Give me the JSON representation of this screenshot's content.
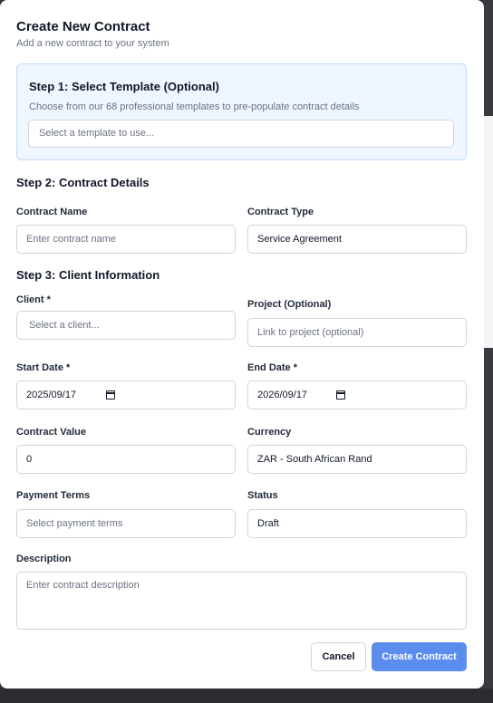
{
  "modal": {
    "title": "Create New Contract",
    "subtitle": "Add a new contract to your system"
  },
  "step1": {
    "heading": "Step 1: Select Template (Optional)",
    "description": "Choose from our 68 professional templates to pre-populate contract details",
    "template_placeholder": "Select a template to use..."
  },
  "step2": {
    "heading": "Step 2: Contract Details",
    "contract_name_label": "Contract Name",
    "contract_name_placeholder": "Enter contract name",
    "contract_type_label": "Contract Type",
    "contract_type_value": "Service Agreement"
  },
  "step3": {
    "heading": "Step 3: Client Information",
    "client_label": "Client *",
    "client_placeholder": "Select a client...",
    "project_label": "Project (Optional)",
    "project_placeholder": "Link to project (optional)",
    "start_date_label": "Start Date *",
    "start_date_value": "2025/09/17",
    "end_date_label": "End Date *",
    "end_date_value": "2026/09/17",
    "contract_value_label": "Contract Value",
    "contract_value": "0",
    "currency_label": "Currency",
    "currency_value": "ZAR - South African Rand",
    "payment_terms_label": "Payment Terms",
    "payment_terms_placeholder": "Select payment terms",
    "status_label": "Status",
    "status_value": "Draft",
    "description_label": "Description",
    "description_placeholder": "Enter contract description"
  },
  "actions": {
    "cancel_label": "Cancel",
    "create_label": "Create Contract"
  },
  "colors": {
    "primary_button": "#5b8def",
    "template_box_bg": "#eff6ff",
    "template_box_border": "#bfdbfe"
  }
}
